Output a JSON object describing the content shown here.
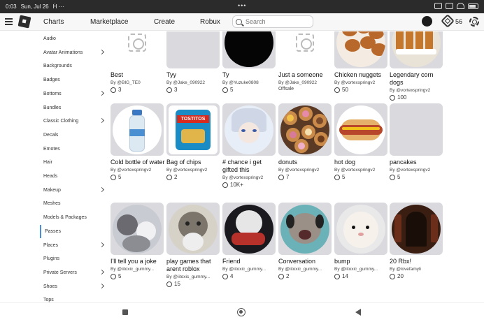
{
  "status": {
    "time": "0:03",
    "date": "Sun, Jul 26",
    "extra": "Ḣ ···",
    "dots": "•••"
  },
  "nav": {
    "links": [
      "Charts",
      "Marketplace",
      "Create",
      "Robux"
    ],
    "search_placeholder": "Search",
    "robux_count": "56"
  },
  "sidebar": {
    "items": [
      {
        "label": "Audio",
        "chevron": false
      },
      {
        "label": "Avatar Animations",
        "chevron": true
      },
      {
        "label": "Backgrounds",
        "chevron": false
      },
      {
        "label": "Badges",
        "chevron": false
      },
      {
        "label": "Bottoms",
        "chevron": true
      },
      {
        "label": "Bundles",
        "chevron": false
      },
      {
        "label": "Classic Clothing",
        "chevron": true
      },
      {
        "label": "Decals",
        "chevron": false
      },
      {
        "label": "Emotes",
        "chevron": false
      },
      {
        "label": "Hair",
        "chevron": false
      },
      {
        "label": "Heads",
        "chevron": false
      },
      {
        "label": "Makeup",
        "chevron": true
      },
      {
        "label": "Meshes",
        "chevron": false
      },
      {
        "label": "Models & Packages",
        "chevron": false
      },
      {
        "label": "Passes",
        "chevron": false,
        "active": true
      },
      {
        "label": "Places",
        "chevron": true
      },
      {
        "label": "Plugins",
        "chevron": false
      },
      {
        "label": "Private Servers",
        "chevron": true
      },
      {
        "label": "Shoes",
        "chevron": true
      },
      {
        "label": "Tops",
        "chevron": false
      }
    ]
  },
  "items": [
    [
      {
        "name": "Best",
        "creator": "By @BIG_TE0",
        "price": "3",
        "thumb": "placeholder"
      },
      {
        "name": "Tyy",
        "creator": "By @Jake_090922",
        "price": "3",
        "thumb": "gray"
      },
      {
        "name": "Ty",
        "creator": "By @Yuzuke0808",
        "price": "5",
        "thumb": "black"
      },
      {
        "name": "Just a someone",
        "creator": "By @Jake_090922",
        "offsale": "Offsale",
        "thumb": "placeholder"
      },
      {
        "name": "Chicken nuggets",
        "creator": "By @vortexspringv2",
        "price": "50",
        "thumb": "nuggets"
      },
      {
        "name": "Legendary corn dogs",
        "creator": "By @vortexspringv2",
        "price": "100",
        "thumb": "corndogs"
      }
    ],
    [
      {
        "name": "Cold bottle of water",
        "creator": "By @vortexspringv2",
        "price": "5",
        "thumb": "water"
      },
      {
        "name": "Bag of chips",
        "creator": "By @vortexspringv2",
        "price": "2",
        "thumb": "chips",
        "chip_text": "TOSTITOS"
      },
      {
        "name": "# chance i get gifted this",
        "creator": "By @vortexspringv2",
        "price": "10K+",
        "thumb": "anime"
      },
      {
        "name": "donuts",
        "creator": "By @vortexspringv2",
        "price": "7",
        "thumb": "donuts"
      },
      {
        "name": "hot dog",
        "creator": "By @vortexspringv2",
        "price": "5",
        "thumb": "hotdog"
      },
      {
        "name": "pancakes",
        "creator": "By @vortexspringv2",
        "price": "5",
        "thumb": "gray"
      }
    ],
    [
      {
        "name": "I'll tell you a joke",
        "creator": "By @iitoxic_gummy...",
        "price": "5",
        "thumb": "cats"
      },
      {
        "name": "play games that arent roblox",
        "creator": "By @iitoxic_gummy...",
        "price": "15",
        "thumb": "cat2"
      },
      {
        "name": "Friend",
        "creator": "By @iitoxic_gummy...",
        "price": "4",
        "thumb": "catguitar"
      },
      {
        "name": "Conversation",
        "creator": "By @iitoxic_gummy...",
        "price": "2",
        "thumb": "cathead"
      },
      {
        "name": "bump",
        "creator": "By @iitoxic_gummy...",
        "price": "14",
        "thumb": "hamster"
      },
      {
        "name": "20 Rbx!",
        "creator": "By @lovefamyli",
        "price": "20",
        "thumb": "dark"
      }
    ]
  ]
}
